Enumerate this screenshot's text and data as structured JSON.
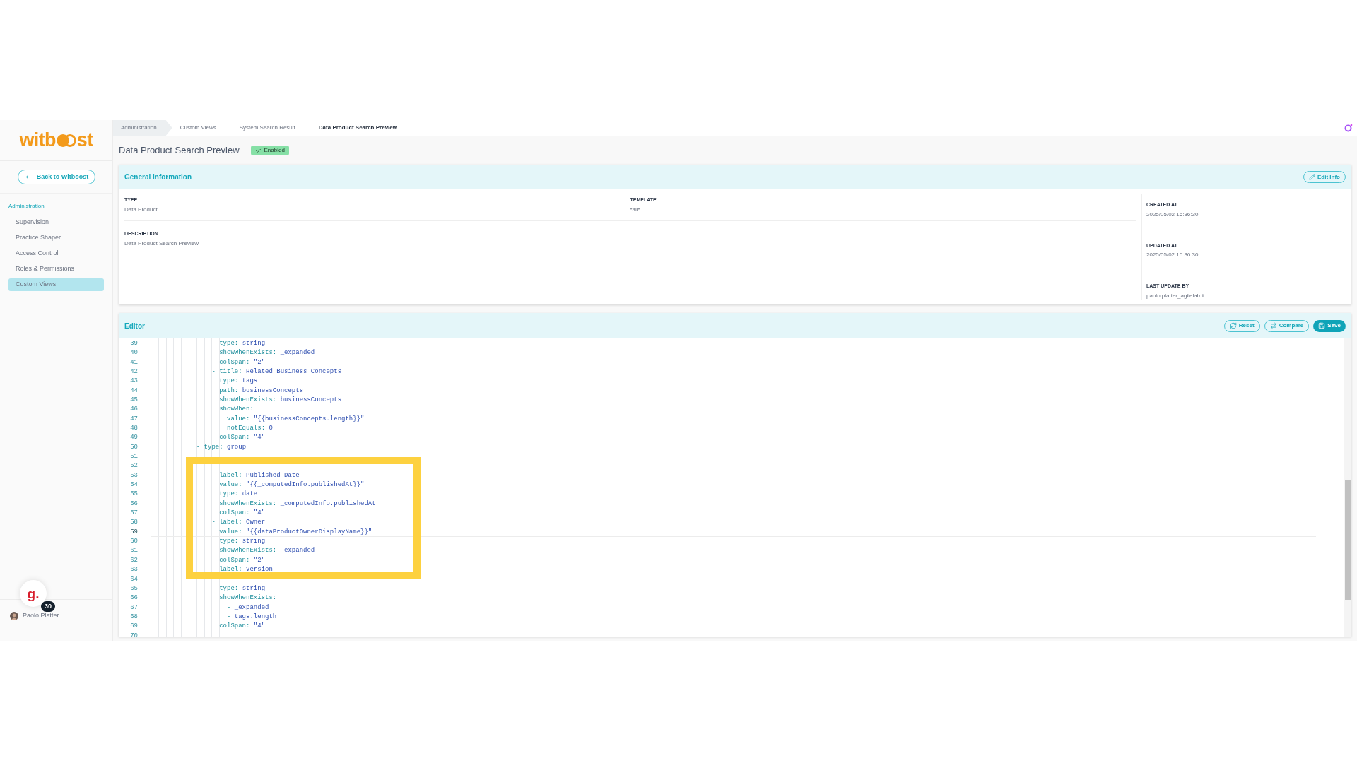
{
  "sidebar": {
    "logo": [
      "witb",
      "st"
    ],
    "back_button": "Back to Witboost",
    "section": "Administration",
    "items": [
      {
        "label": "Supervision",
        "selected": false
      },
      {
        "label": "Practice Shaper",
        "selected": false
      },
      {
        "label": "Access Control",
        "selected": false
      },
      {
        "label": "Roles & Permissions",
        "selected": false
      },
      {
        "label": "Custom Views",
        "selected": true
      }
    ],
    "assistant": {
      "glyph": "g.",
      "badge": "30"
    },
    "user": {
      "name": "Paolo Platter"
    }
  },
  "breadcrumbs": [
    {
      "label": "Administration",
      "selected": false
    },
    {
      "label": "Custom Views",
      "selected": false
    },
    {
      "label": "System Search Result",
      "selected": false
    },
    {
      "label": "Data Product Search Preview",
      "selected": true
    }
  ],
  "page": {
    "title": "Data Product Search Preview",
    "status": {
      "label": "Enabled",
      "enabled": true
    }
  },
  "general": {
    "title": "General Information",
    "edit_button": "Edit Info",
    "fields": [
      {
        "label": "TYPE",
        "value": "Data Product"
      },
      {
        "label": "TEMPLATE",
        "value": "*all*"
      }
    ],
    "description": {
      "label": "DESCRIPTION",
      "value": "Data Product Search Preview"
    },
    "meta": [
      {
        "label": "CREATED AT",
        "value": "2025/05/02 16:36:30"
      },
      {
        "label": "UPDATED AT",
        "value": "2025/05/02 16:36:30"
      },
      {
        "label": "LAST UPDATE BY",
        "value": "paolo.platter_agilelab.it"
      }
    ]
  },
  "editor": {
    "title": "Editor",
    "buttons": [
      {
        "label": "Reset",
        "kind": "reset"
      },
      {
        "label": "Compare",
        "kind": "compare"
      },
      {
        "label": "Save",
        "kind": "save"
      }
    ],
    "lines": [
      {
        "n": "39",
        "key": "                  type:",
        "value": "string"
      },
      {
        "n": "40",
        "key": "                  showWhenExists:",
        "value": "_expanded"
      },
      {
        "n": "41",
        "key": "                  colSpan:",
        "value": "\"2\""
      },
      {
        "n": "42",
        "key": "                - title:",
        "value": "Related Business Concepts"
      },
      {
        "n": "43",
        "key": "                  type:",
        "value": "tags"
      },
      {
        "n": "44",
        "key": "                  path:",
        "value": "businessConcepts"
      },
      {
        "n": "45",
        "key": "                  showWhenExists:",
        "value": "businessConcepts"
      },
      {
        "n": "46",
        "key": "                  showWhen:"
      },
      {
        "n": "47",
        "key": "                    value:",
        "value": "\"{{businessConcepts.length}}\""
      },
      {
        "n": "48",
        "key": "                    notEquals:",
        "value": "0"
      },
      {
        "n": "49",
        "key": "                  colSpan:",
        "value": "\"4\""
      },
      {
        "n": "50",
        "key": "            - type:",
        "value": "group"
      },
      {
        "n": "51"
      },
      {
        "n": "52"
      },
      {
        "n": "53",
        "key": "                - label:",
        "value": "Published Date"
      },
      {
        "n": "54",
        "key": "                  value:",
        "value": "\"{{_computedInfo.publishedAt}}\""
      },
      {
        "n": "55",
        "key": "                  type:",
        "value": "date"
      },
      {
        "n": "56",
        "key": "                  showWhenExists:",
        "value": "_computedInfo.publishedAt"
      },
      {
        "n": "57",
        "key": "                  colSpan:",
        "value": "\"4\""
      },
      {
        "n": "58",
        "key": "                - label:",
        "value": "Owner"
      },
      {
        "n": "59",
        "key": "                  value:",
        "value": "\"{{dataProductOwnerDisplayName}}\"",
        "active": true
      },
      {
        "n": "60",
        "key": "                  type:",
        "value": "string"
      },
      {
        "n": "61",
        "key": "                  showWhenExists:",
        "value": "_expanded"
      },
      {
        "n": "62",
        "key": "                  colSpan:",
        "value": "\"2\""
      },
      {
        "n": "63",
        "key": "                - label:",
        "value": "Version"
      },
      {
        "n": "64"
      },
      {
        "n": "65",
        "key": "                  type:",
        "value": "string"
      },
      {
        "n": "66",
        "key": "                  showWhenExists:"
      },
      {
        "n": "67",
        "key": "                    -",
        "value": "_expanded"
      },
      {
        "n": "68",
        "key": "                    -",
        "value": "tags.length"
      },
      {
        "n": "69",
        "key": "                  colSpan:",
        "value": "\"4\""
      },
      {
        "n": "70"
      }
    ]
  }
}
